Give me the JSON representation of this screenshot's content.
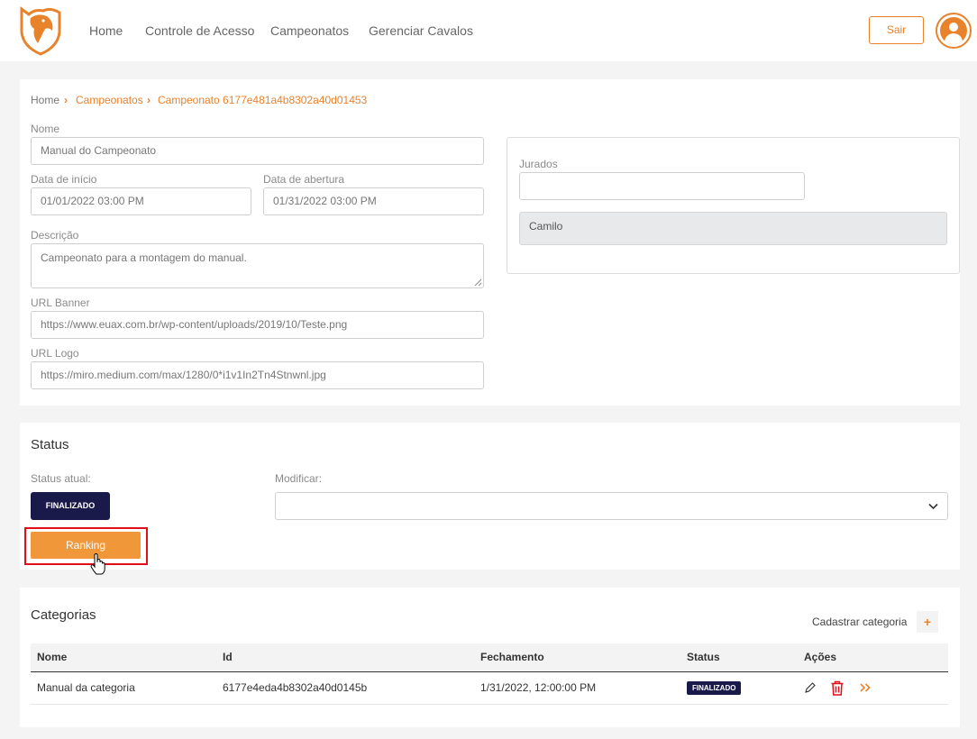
{
  "nav": {
    "home": "Home",
    "access": "Controle de Acesso",
    "championships": "Campeonatos",
    "horses": "Gerenciar Cavalos",
    "logout": "Sair"
  },
  "breadcrumb": {
    "home": "Home",
    "championships": "Campeonatos",
    "current": "Campeonato 6177e481a4b8302a40d01453"
  },
  "form": {
    "name_label": "Nome",
    "name_value": "Manual do Campeonato",
    "start_label": "Data de início",
    "start_value": "01/01/2022 03:00 PM",
    "open_label": "Data de abertura",
    "open_value": "01/31/2022 03:00 PM",
    "desc_label": "Descrição",
    "desc_value": "Campeonato para a montagem do manual.",
    "banner_label": "URL Banner",
    "banner_value": "https://www.euax.com.br/wp-content/uploads/2019/10/Teste.png",
    "logo_label": "URL Logo",
    "logo_value": "https://miro.medium.com/max/1280/0*i1v1In2Tn4Stnwnl.jpg"
  },
  "judges": {
    "label": "Jurados",
    "input_value": "",
    "selected": "Camilo"
  },
  "status": {
    "title": "Status",
    "current_label": "Status atual:",
    "current_value": "FINALIZADO",
    "modify_label": "Modificar:",
    "modify_value": "",
    "ranking_button": "Ranking"
  },
  "categories": {
    "title": "Categorias",
    "add_label": "Cadastrar categoria",
    "add_icon": "+",
    "columns": [
      "Nome",
      "Id",
      "Fechamento",
      "Status",
      "Ações"
    ],
    "rows": [
      {
        "name": "Manual da categoria",
        "id": "6177e4eda4b8302a40d0145b",
        "closing": "1/31/2022, 12:00:00 PM",
        "status": "FINALIZADO"
      }
    ]
  },
  "colors": {
    "accent": "#e8822b",
    "dark_badge": "#1a1a4a",
    "highlight": "#e0101a"
  },
  "icons": [
    "horse-logo-icon",
    "chevron-right-icon",
    "user-avatar-icon",
    "chevron-down-icon",
    "pencil-icon",
    "trash-icon",
    "double-chevron-right-icon",
    "plus-icon",
    "hand-cursor-icon"
  ]
}
